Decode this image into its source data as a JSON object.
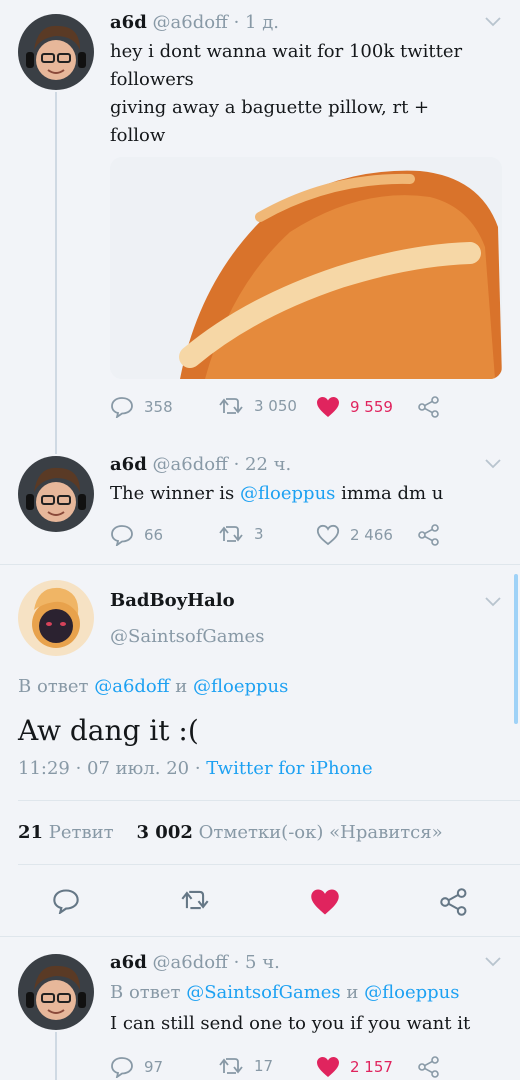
{
  "tweets": [
    {
      "name": "a6d",
      "handle": "@a6doff",
      "time": "1 д.",
      "lines": [
        "hey i dont wanna wait for 100k twitter",
        "followers",
        "giving away a baguette pillow, rt +",
        "follow"
      ],
      "replies": "358",
      "retweets": "3 050",
      "likes": "9 559",
      "liked": true
    },
    {
      "name": "a6d",
      "handle": "@a6doff",
      "time": "22 ч.",
      "text_before": "The winner is ",
      "mention": "@floeppus",
      "text_after": " imma dm u",
      "replies": "66",
      "retweets": "3",
      "likes": "2 466",
      "liked": false
    }
  ],
  "focus": {
    "name": "BadBoyHalo",
    "handle": "@SaintsofGames",
    "reply_prefix": "В ответ ",
    "reply_mention_1": "@a6doff",
    "reply_and": " и ",
    "reply_mention_2": "@floeppus",
    "text": "Aw dang it :(",
    "time": "11:29 · 07 июл. 20",
    "source": "Twitter for iPhone",
    "retweet_count": "21",
    "retweet_label": "Ретвит",
    "like_count": "3 002",
    "like_label": "Отметки(-ок) «Нравится»"
  },
  "reply": {
    "name": "a6d",
    "handle": "@a6doff",
    "time": "5 ч.",
    "reply_prefix": "В ответ ",
    "reply_mention_1": "@SaintsofGames",
    "reply_and": " и ",
    "reply_mention_2": "@floeppus",
    "text": "I can still send one to you if you want it",
    "replies": "97",
    "retweets": "17",
    "likes": "2 157",
    "liked": true
  },
  "separator": " · ",
  "colors": {
    "link": "#1da1f2",
    "like": "#e0245e",
    "muted": "#8899a6"
  }
}
